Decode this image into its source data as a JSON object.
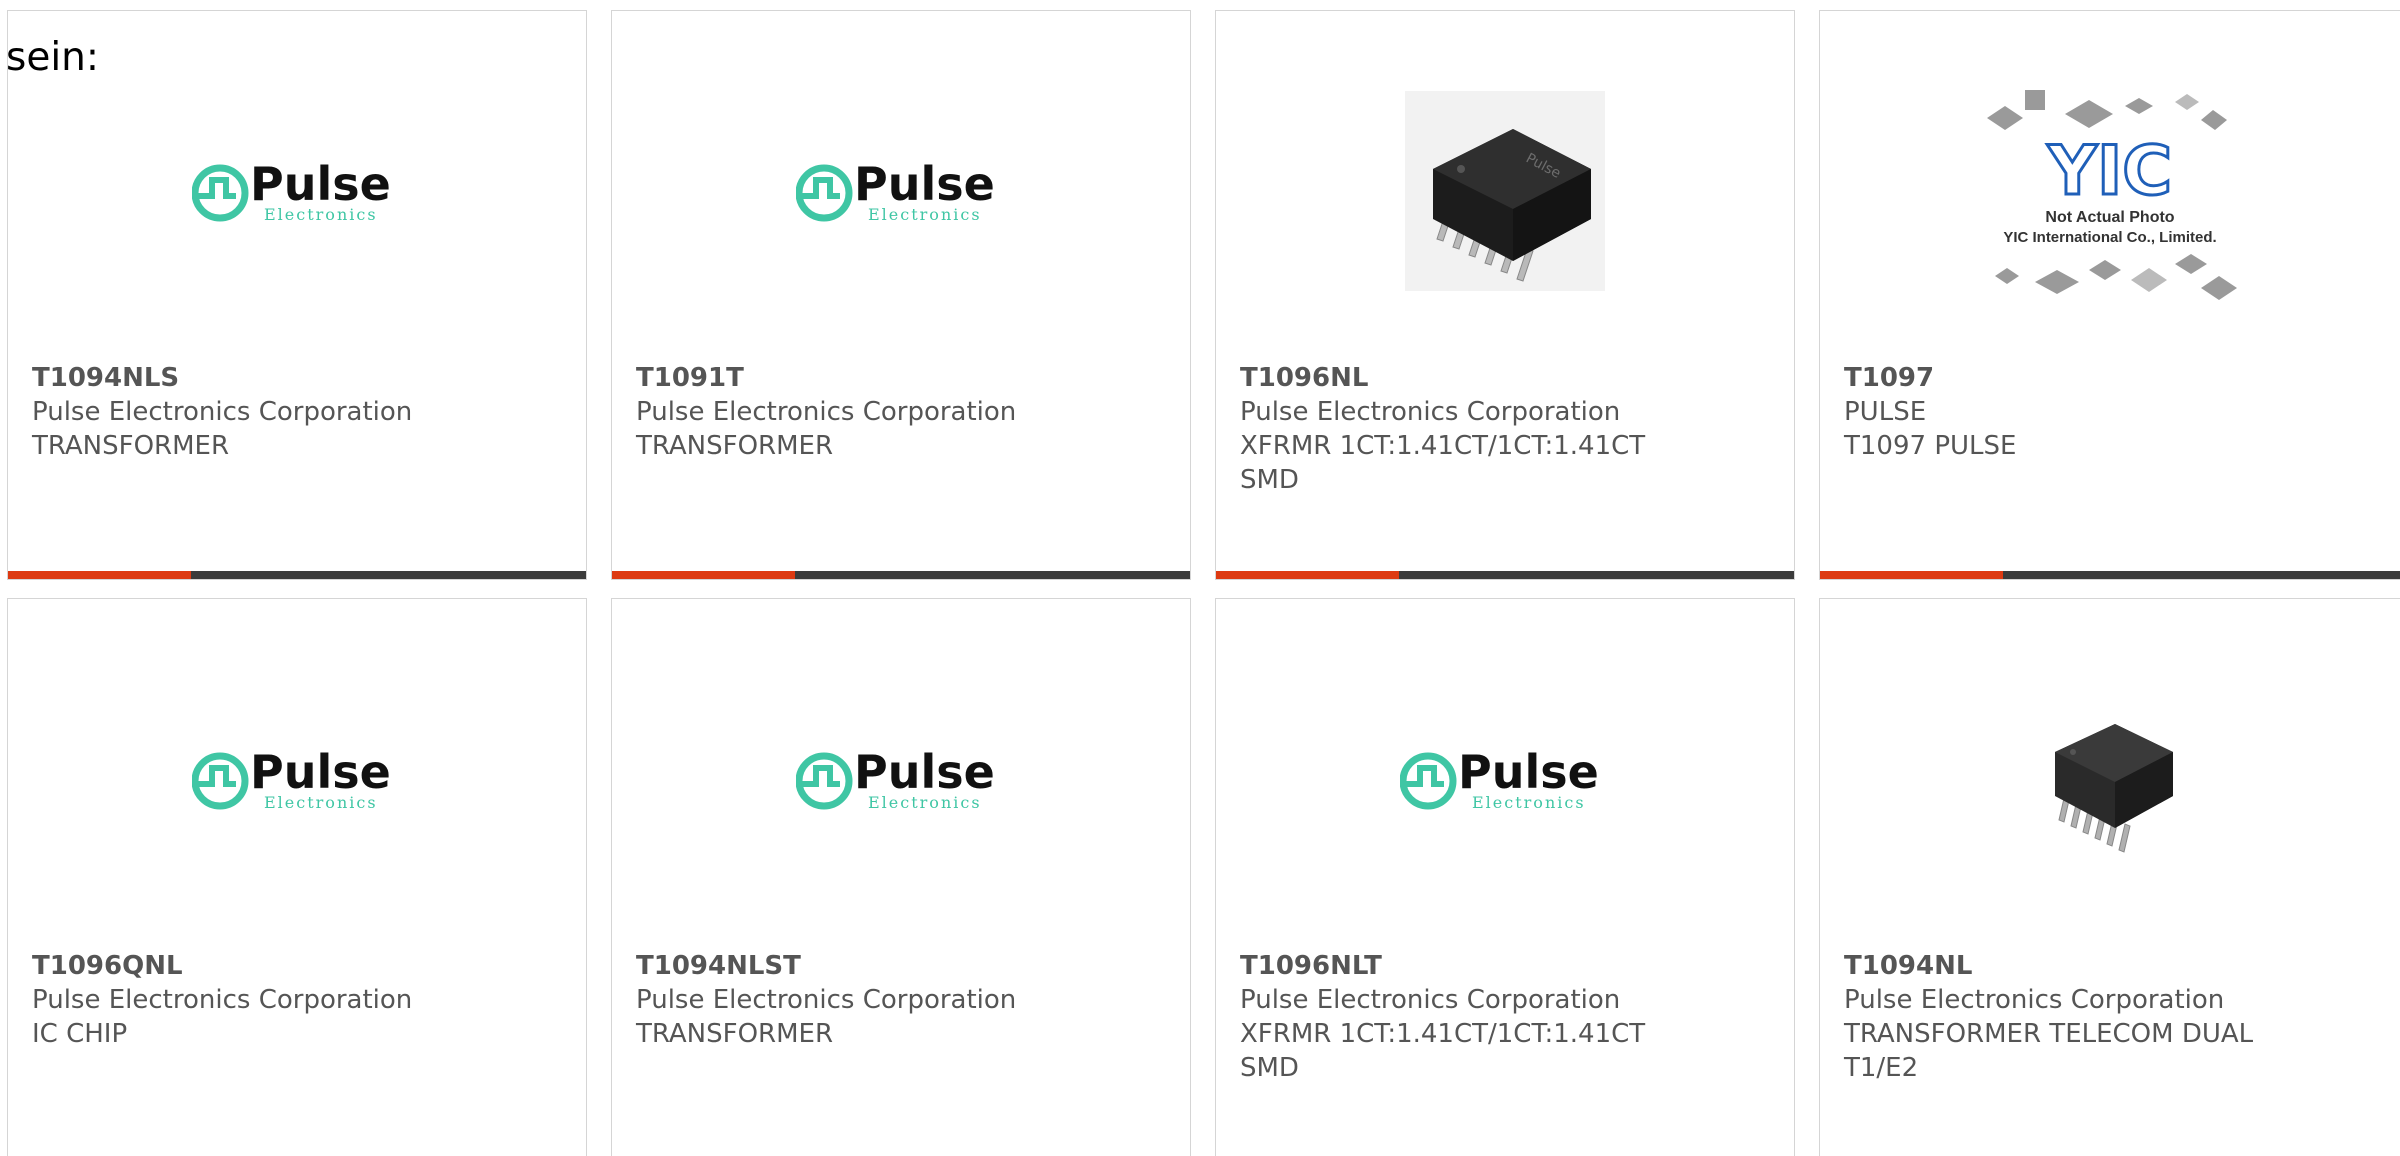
{
  "lead_text": "sein:",
  "colors": {
    "pulse_teal": "#3fc6a4",
    "pulse_text": "#111111",
    "accent_bar": "#dd3a12",
    "dark_bar": "#3b3b3b",
    "card_text": "#555555",
    "yic_blue": "#1f5fb8"
  },
  "logo": {
    "brand": "Pulse",
    "sub": "Electronics"
  },
  "yic": {
    "mark": "YIC",
    "line1": "Not Actual Photo",
    "line2": "YIC International Co., Limited."
  },
  "cards": [
    {
      "part": "T1094NLS",
      "maker": "Pulse Electronics Corporation",
      "desc": "TRANSFORMER",
      "image": "pulse-logo"
    },
    {
      "part": "T1091T",
      "maker": "Pulse Electronics Corporation",
      "desc": "TRANSFORMER",
      "image": "pulse-logo"
    },
    {
      "part": "T1096NL",
      "maker": "Pulse Electronics Corporation",
      "desc": "XFRMR 1CT:1.41CT/1CT:1.41CT SMD",
      "image": "smd-transformer-photo"
    },
    {
      "part": "T1097",
      "maker": "PULSE",
      "desc": "T1097 PULSE",
      "image": "yic-placeholder"
    },
    {
      "part": "T1096QNL",
      "maker": "Pulse Electronics Corporation",
      "desc": "IC CHIP",
      "image": "pulse-logo"
    },
    {
      "part": "T1094NLST",
      "maker": "Pulse Electronics Corporation",
      "desc": "TRANSFORMER",
      "image": "pulse-logo"
    },
    {
      "part": "T1096NLT",
      "maker": "Pulse Electronics Corporation",
      "desc": "XFRMR 1CT:1.41CT/1CT:1.41CT SMD",
      "image": "pulse-logo"
    },
    {
      "part": "T1094NL",
      "maker": "Pulse Electronics Corporation",
      "desc": "TRANSFORMER TELECOM DUAL T1/E2",
      "image": "smd-transformer-photo-small"
    }
  ]
}
